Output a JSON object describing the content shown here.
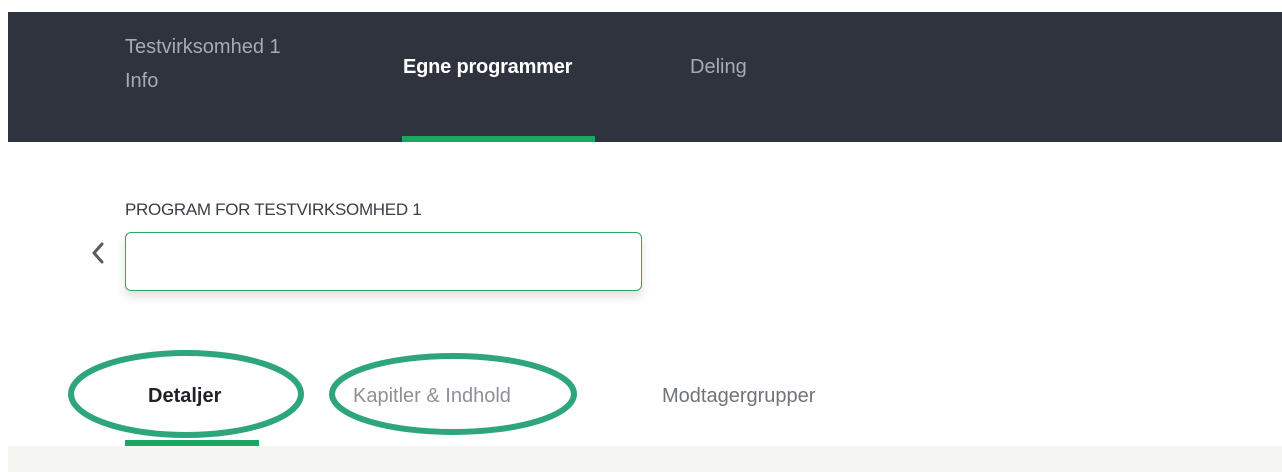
{
  "topnav": {
    "info_line1": "Testvirksomhed 1",
    "info_line2": "Info",
    "own_programs": "Egne programmer",
    "sharing": "Deling",
    "active_tab": "Egne programmer"
  },
  "program": {
    "title": "PROGRAM FOR TESTVIRKSOMHED 1",
    "name_value": "",
    "back_icon": "chevron-left-icon"
  },
  "subtabs": {
    "details": "Detaljer",
    "chapters": "Kapitler & Indhold",
    "groups": "Modtagergrupper",
    "active_tab": "Detaljer"
  },
  "colors": {
    "nav_background": "#2e333d",
    "accent_green": "#17a864",
    "annotation_green": "#2fa57c",
    "content_band": "#f5f6f1"
  }
}
